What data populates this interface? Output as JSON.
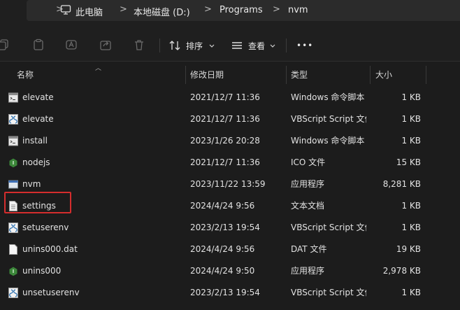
{
  "breadcrumb": {
    "items": [
      "此电脑",
      "本地磁盘 (D:)",
      "Programs",
      "nvm"
    ],
    "separator": ">"
  },
  "toolbar": {
    "sort_label": "排序",
    "view_label": "查看",
    "more_label": "•••"
  },
  "columns": {
    "name": "名称",
    "date": "修改日期",
    "type": "类型",
    "size": "大小"
  },
  "files": [
    {
      "name": "elevate",
      "date": "2021/12/7 11:36",
      "type": "Windows 命令脚本",
      "size": "1 KB",
      "icon": "cmd-script-icon"
    },
    {
      "name": "elevate",
      "date": "2021/12/7 11:36",
      "type": "VBScript Script 文件",
      "size": "1 KB",
      "icon": "vbscript-icon"
    },
    {
      "name": "install",
      "date": "2023/1/26 20:28",
      "type": "Windows 命令脚本",
      "size": "1 KB",
      "icon": "cmd-script-icon"
    },
    {
      "name": "nodejs",
      "date": "2021/12/7 11:36",
      "type": "ICO 文件",
      "size": "15 KB",
      "icon": "nodejs-icon"
    },
    {
      "name": "nvm",
      "date": "2023/11/22 13:59",
      "type": "应用程序",
      "size": "8,281 KB",
      "icon": "application-icon"
    },
    {
      "name": "settings",
      "date": "2024/4/24 9:56",
      "type": "文本文档",
      "size": "1 KB",
      "icon": "text-document-icon"
    },
    {
      "name": "setuserenv",
      "date": "2023/2/13 19:54",
      "type": "VBScript Script 文件",
      "size": "1 KB",
      "icon": "vbscript-icon"
    },
    {
      "name": "unins000.dat",
      "date": "2024/4/24 9:56",
      "type": "DAT 文件",
      "size": "19 KB",
      "icon": "blank-file-icon"
    },
    {
      "name": "unins000",
      "date": "2024/4/24 9:50",
      "type": "应用程序",
      "size": "2,978 KB",
      "icon": "nodejs-icon"
    },
    {
      "name": "unsetuserenv",
      "date": "2023/2/13 19:54",
      "type": "VBScript Script 文件",
      "size": "1 KB",
      "icon": "vbscript-icon"
    }
  ],
  "highlighted_file": "settings",
  "colors": {
    "background": "#1c1c1c",
    "highlight_border": "#d42d2d",
    "nodejs_green": "#3c873a"
  }
}
